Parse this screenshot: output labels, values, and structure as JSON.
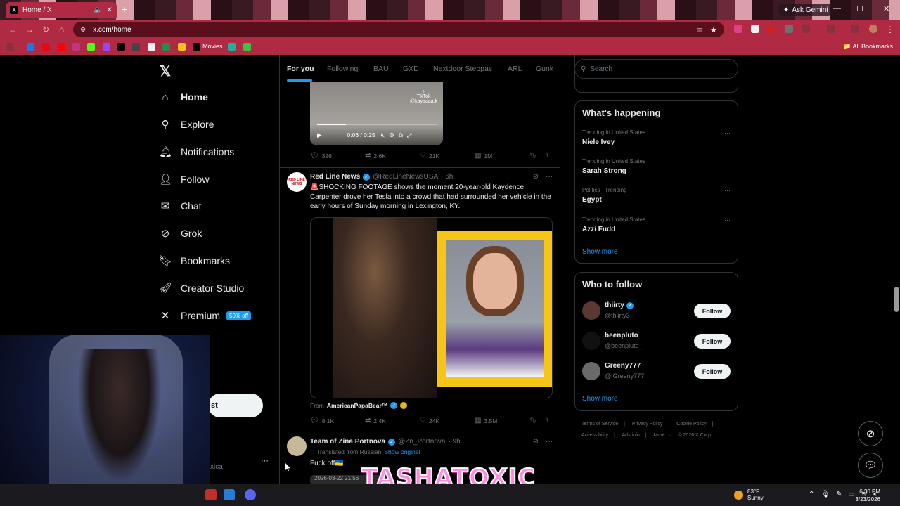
{
  "browser": {
    "tab_title": "Home / X",
    "tab_favicon": "X",
    "url": "x.com/home",
    "ask_gemini": "Ask Gemini",
    "bookmark_movies": "Movies",
    "all_bookmarks": "All Bookmarks"
  },
  "nav": {
    "items": [
      {
        "label": "Home",
        "icon": "home-icon"
      },
      {
        "label": "Explore",
        "icon": "search-icon"
      },
      {
        "label": "Notifications",
        "icon": "bell-icon"
      },
      {
        "label": "Follow",
        "icon": "person-add-icon"
      },
      {
        "label": "Chat",
        "icon": "mail-icon"
      },
      {
        "label": "Grok",
        "icon": "grok-icon"
      },
      {
        "label": "Bookmarks",
        "icon": "bookmark-icon"
      },
      {
        "label": "Creator Studio",
        "icon": "rocket-icon"
      },
      {
        "label": "Premium",
        "icon": "x-icon"
      }
    ],
    "premium_badge": "50% off",
    "post_button_fragment": "st",
    "account_fragment": "xica"
  },
  "timeline": {
    "tabs": [
      "For you",
      "Following",
      "BAU",
      "GXD",
      "Nextdoor Steppas",
      "ARL",
      "Gunk"
    ],
    "active_tab": "For you",
    "tweet1": {
      "video_time": "0:06 / 0:25",
      "video_progress": 0.24,
      "tiktok_label": "TikTok",
      "tiktok_handle": "@kayaaaa.k",
      "replies": "326",
      "reposts": "2.6K",
      "likes": "21K",
      "views": "1M"
    },
    "tweet2": {
      "name": "Red Line News",
      "handle": "@RedLineNewsUSA",
      "time": "· 6h",
      "avatar_label": "RED LINE NEWS",
      "text": "🚨SHOCKING FOOTAGE shows the moment 20-year-old Kaydence Carpenter drove her Tesla into a crowd that had surrounded her vehicle in the early hours of Sunday morning in Lexington, KY.",
      "from_label": "From",
      "from_name": "AmericanPapaBear™",
      "replies": "8.1K",
      "reposts": "2.4K",
      "likes": "24K",
      "views": "3.5M"
    },
    "tweet3": {
      "name": "Team of Zina Portnova",
      "handle": "@Zn_Portnova",
      "time": "· 9h",
      "translated": "Translated from Russian",
      "show_original": "Show original",
      "text": "Fuck off🇺🇦",
      "date_fragment": "2026-03-22 21:56"
    }
  },
  "sidebar": {
    "search_placeholder": "Search",
    "whats_happening": "What's happening",
    "trends": [
      {
        "meta": "Trending in United States",
        "name": "Niele Ivey"
      },
      {
        "meta": "Trending in United States",
        "name": "Sarah Strong"
      },
      {
        "meta": "Politics · Trending",
        "name": "Egypt"
      },
      {
        "meta": "Trending in United States",
        "name": "Azzi Fudd"
      }
    ],
    "show_more": "Show more",
    "who_to_follow": "Who to follow",
    "follow_suggestions": [
      {
        "name": "thiirty",
        "handle": "@thiirty3",
        "verified": true,
        "button": "Follow"
      },
      {
        "name": "beenpluto",
        "handle": "@beenpluto_",
        "verified": false,
        "button": "Follow"
      },
      {
        "name": "Greeny777",
        "handle": "@IGreeny777",
        "verified": false,
        "button": "Follow"
      }
    ],
    "show_more_2": "Show more",
    "footer": [
      "Terms of Service",
      "|",
      "Privacy Policy",
      "|",
      "Cookie Policy",
      "|",
      "Accessibility",
      "|",
      "Ads info",
      "|",
      "More ···",
      "© 2026 X Corp."
    ]
  },
  "overlay": {
    "streamer_name": "TASHATOXIC"
  },
  "taskbar": {
    "temperature": "83°F",
    "weather": "Sunny",
    "time": "6:30 PM",
    "date": "3/23/2026"
  },
  "colors": {
    "accent": "#1d9bf0",
    "browser_chrome": "#b02a44",
    "page_bg": "#000000"
  }
}
